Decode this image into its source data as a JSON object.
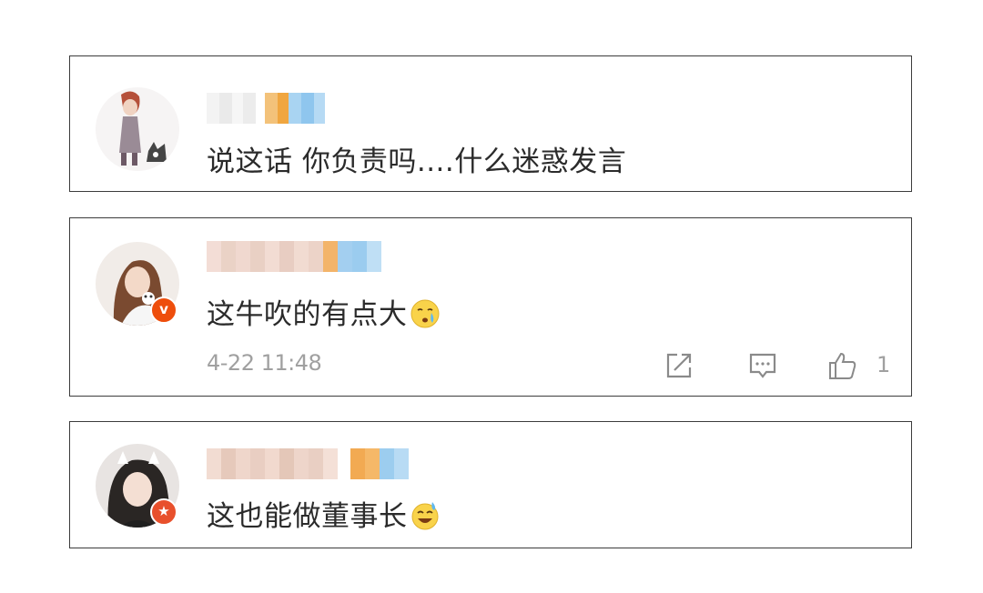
{
  "comments": [
    {
      "text": "说这话 你负责吗....什么迷惑发言"
    },
    {
      "text": "这牛吹的有点大",
      "emoji_icon": "crying-face-icon",
      "badge_icon": "verified-v-icon",
      "time": "4-22 11:48",
      "like_count": "1",
      "actions": [
        "share-icon",
        "comment-icon",
        "thumbs-up-icon"
      ]
    },
    {
      "text": "这也能做董事长",
      "emoji_icon": "sweat-smile-face-icon",
      "badge_icon": "star-member-icon"
    }
  ],
  "colors": {
    "border": "#3c3c3c",
    "text": "#2b2b2b",
    "meta": "#a0a0a0",
    "badge_orange": "#ee4e0c"
  }
}
